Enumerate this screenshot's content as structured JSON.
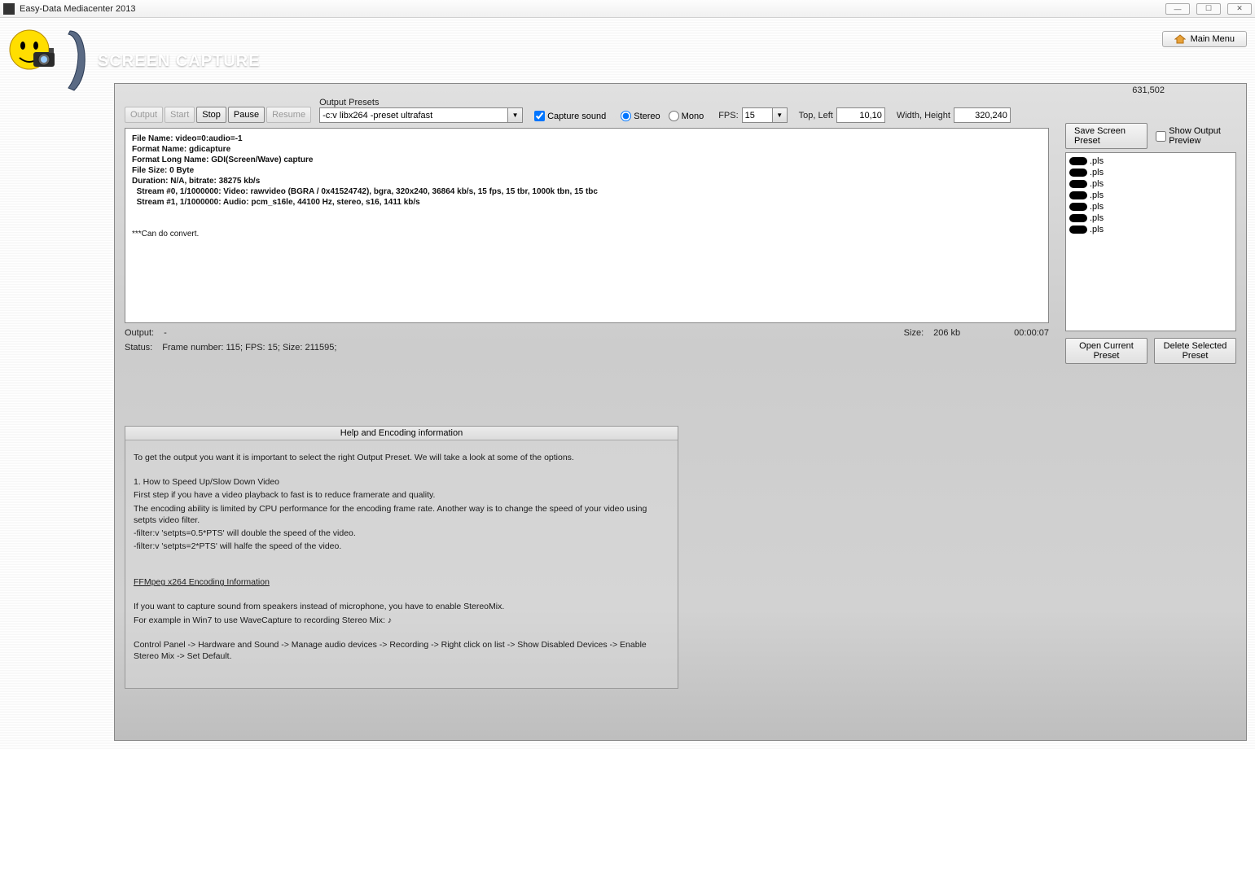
{
  "window": {
    "title": "Easy-Data Mediacenter 2013"
  },
  "header": {
    "page_title": "SCREEN CAPTURE",
    "main_menu": "Main Menu"
  },
  "toolbar": {
    "output": "Output",
    "start": "Start",
    "stop": "Stop",
    "pause": "Pause",
    "resume": "Resume",
    "output_presets_label": "Output Presets",
    "output_preset_value": "-c:v libx264 -preset ultrafast",
    "capture_sound": "Capture sound",
    "stereo": "Stereo",
    "mono": "Mono",
    "fps_label": "FPS:",
    "fps_value": "15",
    "top_left_label": "Top, Left",
    "top_left_value": "10,10",
    "width_height_label": "Width, Height",
    "width_height_value": "320,240",
    "coord_readout": "631,502"
  },
  "right": {
    "save_screen_preset": "Save Screen Preset",
    "show_output_preview": "Show Output Preview",
    "open_current_preset": "Open Current Preset",
    "delete_selected_preset": "Delete Selected Preset",
    "presets": [
      {
        "ext": ".pls"
      },
      {
        "ext": ".pls"
      },
      {
        "ext": ".pls"
      },
      {
        "ext": ".pls"
      },
      {
        "ext": ".pls"
      },
      {
        "ext": ".pls"
      },
      {
        "ext": ".pls"
      }
    ]
  },
  "info": {
    "line_file_name": "File Name: video=0:audio=-1",
    "line_format_name": "Format Name: gdicapture",
    "line_format_long": "Format Long Name: GDI(Screen/Wave) capture",
    "line_file_size": "File Size: 0 Byte",
    "line_duration": "Duration: N/A, bitrate: 38275 kb/s",
    "line_stream0": "  Stream #0, 1/1000000: Video: rawvideo (BGRA / 0x41524742), bgra, 320x240, 36864 kb/s, 15 fps, 15 tbr, 1000k tbn, 15 tbc",
    "line_stream1": "  Stream #1, 1/1000000: Audio: pcm_s16le, 44100 Hz, stereo, s16, 1411 kb/s",
    "line_canconvert": "***Can do convert."
  },
  "status": {
    "output_label": "Output:",
    "output_value": "-",
    "size_label": "Size:",
    "size_value": "206 kb",
    "time_value": "00:00:07",
    "status_label": "Status:",
    "status_value": "Frame number: 115; FPS: 15; Size: 211595;"
  },
  "help": {
    "header": "Help and Encoding information",
    "p1": "To get the output you want it is important to select the right Output Preset. We will take a look at some of the options.",
    "p2": "1. How to Speed Up/Slow Down Video",
    "p3": "First step if you have a video playback to fast is to reduce framerate and quality.",
    "p4": "The encoding ability is limited by CPU performance for the encoding frame rate. Another way is to change the speed of your video using setpts video filter.",
    "p5": "-filter:v 'setpts=0.5*PTS' will double the speed of the video.",
    "p6": "-filter:v 'setpts=2*PTS' will halfe the speed of the video.",
    "p7": "FFMpeg  x264 Encoding Information",
    "p8": "If you want to capture sound from speakers instead of microphone, you have to enable StereoMix.",
    "p9": "For example in Win7 to use WaveCapture to recording Stereo Mix:",
    "p10": "Control Panel -> Hardware and Sound -> Manage audio devices -> Recording -> Right click on list -> Show Disabled Devices -> Enable Stereo Mix -> Set Default."
  }
}
